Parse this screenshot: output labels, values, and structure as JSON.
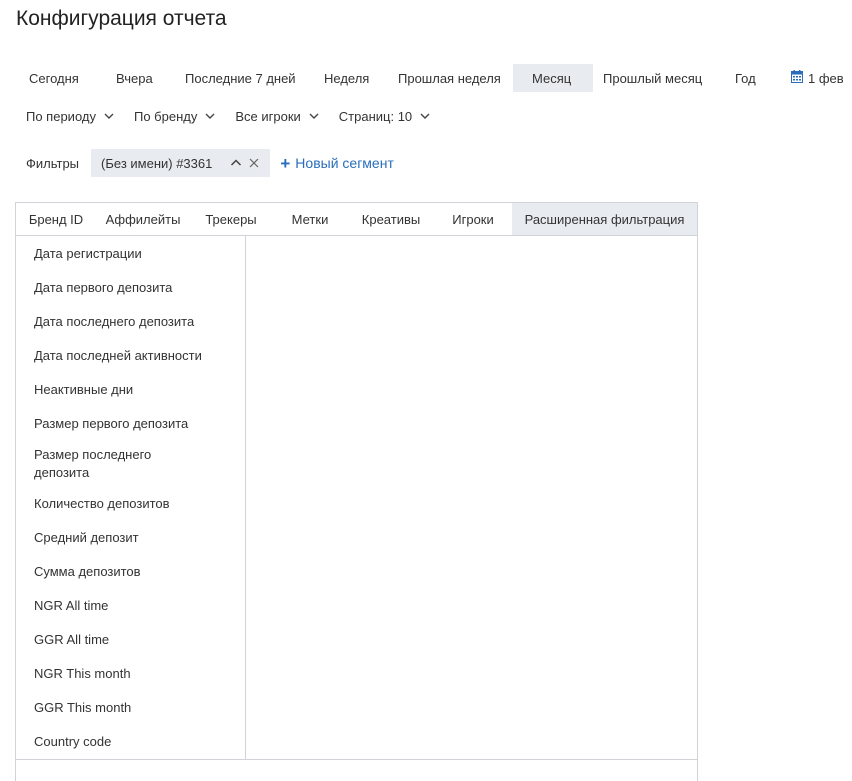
{
  "page": {
    "title": "Конфигурация отчета"
  },
  "period_tabs": [
    {
      "label": "Сегодня"
    },
    {
      "label": "Вчера"
    },
    {
      "label": "Последние 7 дней"
    },
    {
      "label": "Неделя"
    },
    {
      "label": "Прошлая неделя"
    },
    {
      "label": "Месяц",
      "active": true
    },
    {
      "label": "Прошлый месяц"
    },
    {
      "label": "Год"
    },
    {
      "label": "1 фев",
      "icon": "calendar-icon"
    }
  ],
  "dropdowns": [
    {
      "label": "По периоду"
    },
    {
      "label": "По бренду"
    },
    {
      "label": "Все игроки"
    },
    {
      "label": "Страниц: 10"
    }
  ],
  "filters": {
    "label": "Фильтры",
    "segment": "(Без имени) #3361",
    "new_segment": "Новый сегмент"
  },
  "filter_tabs": [
    {
      "label": "Бренд ID"
    },
    {
      "label": "Аффилейты"
    },
    {
      "label": "Трекеры"
    },
    {
      "label": "Метки"
    },
    {
      "label": "Креативы"
    },
    {
      "label": "Игроки"
    },
    {
      "label": "Расширенная фильтрация",
      "active": true
    }
  ],
  "advanced_filters": [
    "Дата регистрации",
    "Дата первого депозита",
    "Дата последнего депозита",
    "Дата последней активности",
    "Неактивные дни",
    "Размер первого депозита",
    "Размер последнего депозита",
    "Количество депозитов",
    "Средний депозит",
    "Сумма депозитов",
    "NGR All time",
    "GGR All time",
    "NGR This month",
    "GGR This month",
    "Country code"
  ],
  "colors": {
    "accent": "#2a6ebb",
    "active_bg": "#e8ecf0",
    "border": "#d0d4d8"
  }
}
